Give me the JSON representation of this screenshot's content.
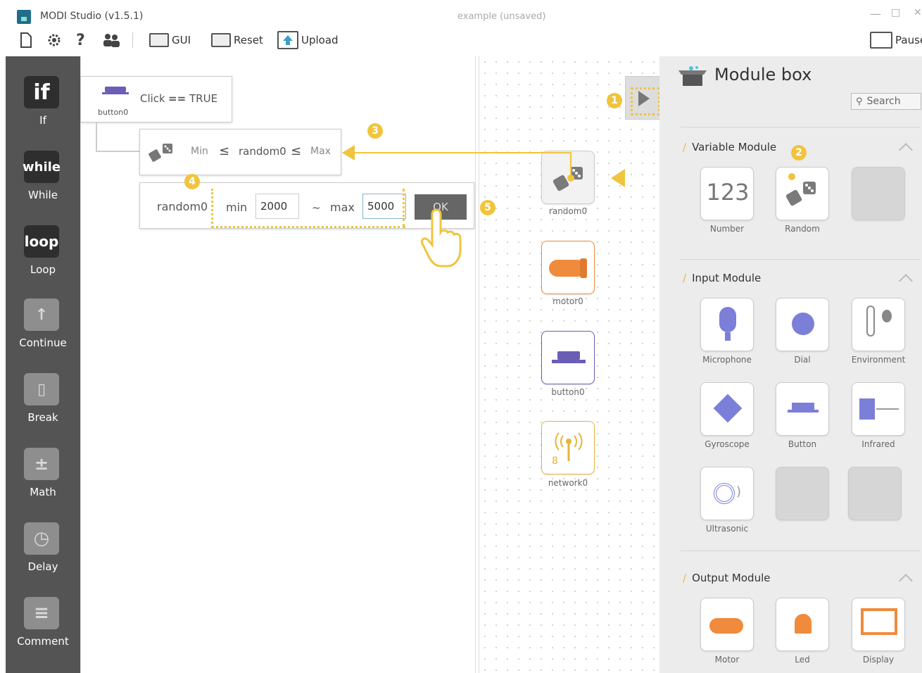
{
  "app": {
    "title": "MODI Studio (v1.5.1)",
    "document": "example (unsaved)",
    "min": "—",
    "max": "□",
    "close": "✕"
  },
  "toolbar": {
    "gui": "GUI",
    "reset": "Reset",
    "upload": "Upload",
    "pause": "Pause"
  },
  "sidebar": {
    "items": [
      {
        "icon_text": "if",
        "label": "If"
      },
      {
        "icon_text": "while",
        "label": "While"
      },
      {
        "icon_text": "loop",
        "label": "Loop"
      },
      {
        "icon_text": "↑",
        "label": "Continue"
      },
      {
        "icon_text": "▯",
        "label": "Break"
      },
      {
        "icon_text": "±",
        "label": "Math"
      },
      {
        "icon_text": "◷",
        "label": "Delay"
      },
      {
        "icon_text": "≡",
        "label": "Comment"
      }
    ]
  },
  "code": {
    "if_block": {
      "module": "button0",
      "condition": "Click",
      "op": "==",
      "value": "TRUE"
    },
    "random_block": {
      "min": "Min",
      "le": "≤",
      "var": "random0",
      "max": "Max"
    },
    "editor": {
      "var": "random0",
      "min_label": "min",
      "min_value": "2000",
      "tilde": "~",
      "max_label": "max",
      "max_value": "5000",
      "ok": "OK"
    }
  },
  "canvas_modules": [
    {
      "label": "random0"
    },
    {
      "label": "motor0"
    },
    {
      "label": "button0"
    },
    {
      "label": "network0"
    }
  ],
  "panel": {
    "title": "Module box",
    "search": "Search",
    "sections": {
      "variable": "Variable Module",
      "input": "Input Module",
      "output": "Output Module"
    },
    "variable_modules": [
      {
        "label": "Number",
        "icon": "123"
      },
      {
        "label": "Random"
      }
    ],
    "input_modules": [
      {
        "label": "Microphone"
      },
      {
        "label": "Dial"
      },
      {
        "label": "Environment"
      },
      {
        "label": "Gyroscope"
      },
      {
        "label": "Button"
      },
      {
        "label": "Infrared"
      },
      {
        "label": "Ultrasonic"
      }
    ],
    "output_modules": [
      {
        "label": "Motor"
      },
      {
        "label": "Led"
      },
      {
        "label": "Display"
      }
    ]
  },
  "badges": [
    "1",
    "2",
    "3",
    "4",
    "5"
  ],
  "colors": {
    "accent": "#f0c43d",
    "sidebar": "#545454",
    "motor": "#f08a3c",
    "button": "#6a5fb5",
    "network": "#e6b43a"
  }
}
